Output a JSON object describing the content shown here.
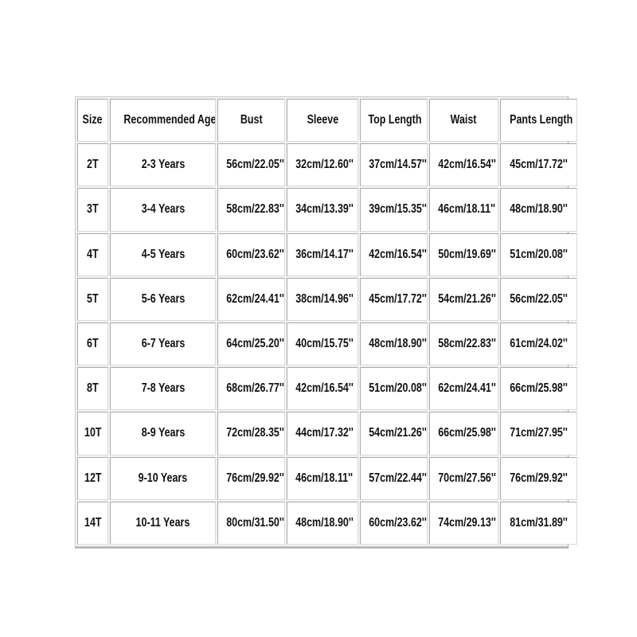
{
  "table": {
    "headers": [
      "Size",
      "Recommended Age",
      "Bust",
      "Sleeve",
      "Top Length",
      "Waist",
      "Pants Length"
    ],
    "rows": [
      [
        "2T",
        "2-3 Years",
        "56cm/22.05''",
        "32cm/12.60''",
        "37cm/14.57''",
        "42cm/16.54''",
        "45cm/17.72''"
      ],
      [
        "3T",
        "3-4 Years",
        "58cm/22.83''",
        "34cm/13.39''",
        "39cm/15.35''",
        "46cm/18.11''",
        "48cm/18.90''"
      ],
      [
        "4T",
        "4-5 Years",
        "60cm/23.62''",
        "36cm/14.17''",
        "42cm/16.54''",
        "50cm/19.69''",
        "51cm/20.08''"
      ],
      [
        "5T",
        "5-6 Years",
        "62cm/24.41''",
        "38cm/14.96''",
        "45cm/17.72''",
        "54cm/21.26''",
        "56cm/22.05''"
      ],
      [
        "6T",
        "6-7 Years",
        "64cm/25.20''",
        "40cm/15.75''",
        "48cm/18.90''",
        "58cm/22.83''",
        "61cm/24.02''"
      ],
      [
        "8T",
        "7-8 Years",
        "68cm/26.77''",
        "42cm/16.54''",
        "51cm/20.08''",
        "62cm/24.41''",
        "66cm/25.98''"
      ],
      [
        "10T",
        "8-9 Years",
        "72cm/28.35''",
        "44cm/17.32''",
        "54cm/21.26''",
        "66cm/25.98''",
        "71cm/27.95''"
      ],
      [
        "12T",
        "9-10 Years",
        "76cm/29.92''",
        "46cm/18.11''",
        "57cm/22.44''",
        "70cm/27.56''",
        "76cm/29.92''"
      ],
      [
        "14T",
        "10-11 Years",
        "80cm/31.50''",
        "48cm/18.90''",
        "60cm/23.62''",
        "74cm/29.13''",
        "81cm/31.89''"
      ]
    ]
  }
}
